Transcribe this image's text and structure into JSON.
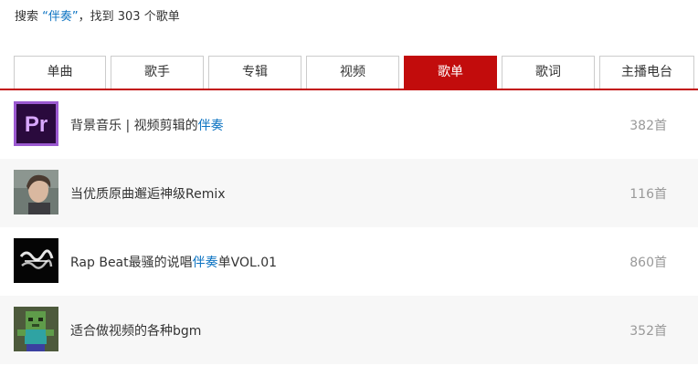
{
  "summary": {
    "prefix": "搜索 ",
    "keyword": "“伴奏”",
    "suffix": "，找到 303 个歌单"
  },
  "tabs": [
    {
      "label": "单曲",
      "active": false
    },
    {
      "label": "歌手",
      "active": false
    },
    {
      "label": "专辑",
      "active": false
    },
    {
      "label": "视频",
      "active": false
    },
    {
      "label": "歌单",
      "active": true
    },
    {
      "label": "歌词",
      "active": false
    },
    {
      "label": "主播电台",
      "active": false
    }
  ],
  "playlists": [
    {
      "title_before": "背景音乐 | 视频剪辑的",
      "title_highlight": "伴奏",
      "title_after": "",
      "count": "382首",
      "cover": "premiere-pro-logo"
    },
    {
      "title_before": "当优质原曲邂逅神级Remix",
      "title_highlight": "",
      "title_after": "",
      "count": "116首",
      "cover": "portrait-photo"
    },
    {
      "title_before": "Rap Beat最骚的说唱",
      "title_highlight": "伴奏",
      "title_after": "单VOL.01",
      "count": "860首",
      "cover": "graffiti-logo"
    },
    {
      "title_before": "适合做视频的各种bgm",
      "title_highlight": "",
      "title_after": "",
      "count": "352首",
      "cover": "minecraft-zombie"
    }
  ],
  "colors": {
    "accent": "#c20c0c",
    "keyword": "#0c73c2",
    "count": "#999999"
  }
}
